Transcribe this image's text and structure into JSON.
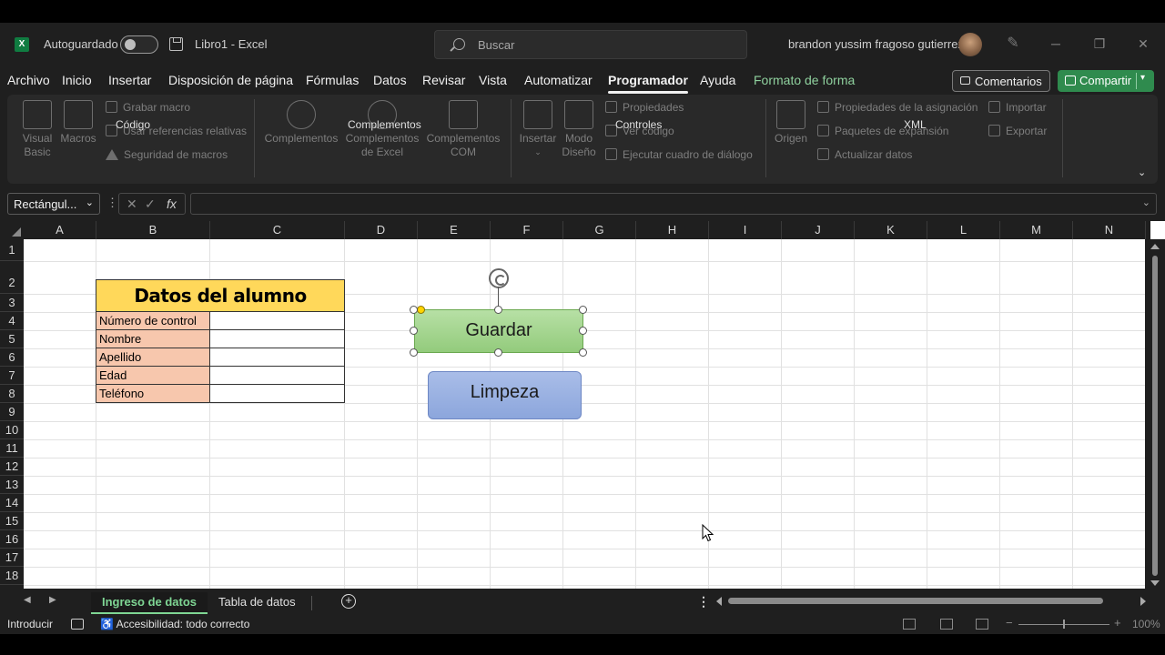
{
  "titlebar": {
    "logo": "X",
    "autosave_label": "Autoguardado",
    "doc_title": "Libro1  -  Excel",
    "search_placeholder": "Buscar",
    "username": "brandon yussim fragoso gutierrez"
  },
  "menu": {
    "tabs": [
      "Archivo",
      "Inicio",
      "Insertar",
      "Disposición de página",
      "Fórmulas",
      "Datos",
      "Revisar",
      "Vista",
      "Automatizar",
      "Programador",
      "Ayuda",
      "Formato de forma"
    ],
    "active_tab": "Programador",
    "comments_label": "Comentarios",
    "share_label": "Compartir"
  },
  "ribbon": {
    "codigo": {
      "label": "Código",
      "visual_basic": "Visual Basic",
      "macros": "Macros",
      "record_macro": "Grabar macro",
      "relative_refs": "Usar referencias relativas",
      "macro_security": "Seguridad de macros"
    },
    "complementos": {
      "label": "Complementos",
      "addins": "Complementos",
      "excel_addins": "Complementos de Excel",
      "com_addins": "Complementos COM"
    },
    "controles": {
      "label": "Controles",
      "insert": "Insertar",
      "design_mode": "Modo Diseño",
      "properties": "Propiedades",
      "view_code": "Ver código",
      "run_dialog": "Ejecutar cuadro de diálogo"
    },
    "xml": {
      "label": "XML",
      "source": "Origen",
      "map_properties": "Propiedades de la asignación",
      "expansion_packs": "Paquetes de expansión",
      "refresh_data": "Actualizar datos",
      "import": "Importar",
      "export": "Exportar"
    }
  },
  "formula_bar": {
    "name_box": "Rectángul...",
    "fx": "fx",
    "value": ""
  },
  "grid": {
    "columns": [
      "A",
      "B",
      "C",
      "D",
      "E",
      "F",
      "G",
      "H",
      "I",
      "J",
      "K",
      "L",
      "M",
      "N"
    ],
    "rows": [
      "1",
      "2",
      "3",
      "4",
      "5",
      "6",
      "7",
      "8",
      "9",
      "10",
      "11",
      "12",
      "13",
      "14",
      "15",
      "16",
      "17",
      "18"
    ],
    "form_title": "Datos del alumno",
    "form_fields": [
      "Número de control",
      "Nombre",
      "Apellido",
      "Edad",
      "Teléfono"
    ]
  },
  "shapes": {
    "save_button": "Guardar",
    "clear_button": "Limpeza"
  },
  "sheets": {
    "tabs": [
      "Ingreso de datos",
      "Tabla de datos"
    ],
    "active": "Ingreso de datos"
  },
  "statusbar": {
    "mode": "Introducir",
    "accessibility": "Accesibilidad: todo correcto",
    "zoom": "100%"
  },
  "colors": {
    "title_fill": "#ffd85a",
    "label_fill": "#f7c7ad",
    "guardar_fill": "#93cb7c",
    "limpeza_fill": "#8ca6dc",
    "share_green": "#2f8b4e"
  }
}
